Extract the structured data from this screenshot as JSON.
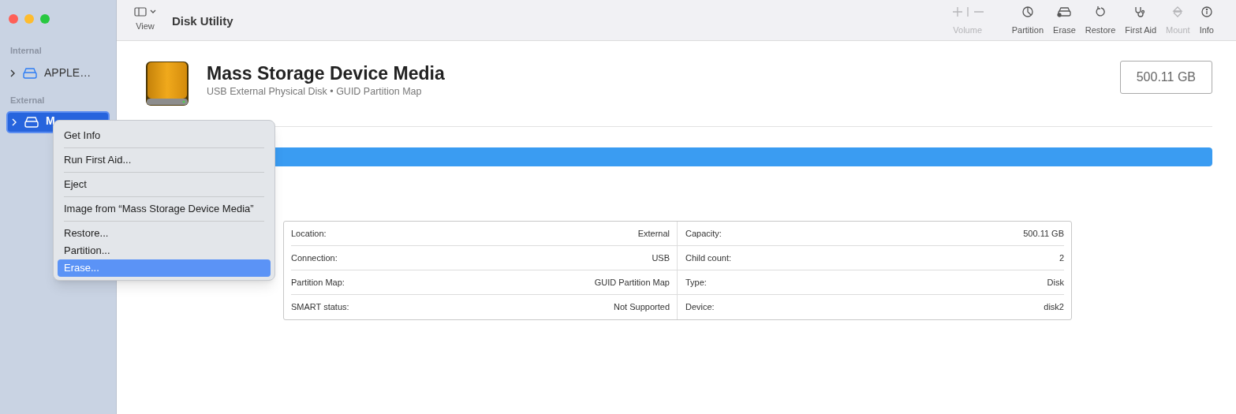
{
  "window": {
    "title": "Disk Utility"
  },
  "view_button": {
    "label": "View"
  },
  "toolbar": [
    {
      "kind": "volume",
      "label": "Volume",
      "disabled": true
    },
    {
      "kind": "partition",
      "label": "Partition",
      "disabled": false
    },
    {
      "kind": "erase",
      "label": "Erase",
      "disabled": false
    },
    {
      "kind": "restore",
      "label": "Restore",
      "disabled": false
    },
    {
      "kind": "firstaid",
      "label": "First Aid",
      "disabled": false
    },
    {
      "kind": "mount",
      "label": "Mount",
      "disabled": true
    },
    {
      "kind": "info",
      "label": "Info",
      "disabled": false
    }
  ],
  "sidebar": {
    "sections": [
      {
        "heading": "Internal",
        "items": [
          {
            "label": "APPLE…",
            "selected": false
          }
        ]
      },
      {
        "heading": "External",
        "items": [
          {
            "label": "M",
            "selected": true
          }
        ]
      }
    ]
  },
  "disk": {
    "name": "Mass Storage Device Media",
    "subtitle": "USB External Physical Disk • GUID Partition Map",
    "size": "500.11 GB",
    "usage": {
      "level": 1
    }
  },
  "details": [
    {
      "label": "Location:",
      "value": "External",
      "label2": "Capacity:",
      "value2": "500.11 GB"
    },
    {
      "label": "Connection:",
      "value": "USB",
      "label2": "Child count:",
      "value2": "2"
    },
    {
      "label": "Partition Map:",
      "value": "GUID Partition Map",
      "label2": "Type:",
      "value2": "Disk"
    },
    {
      "label": "SMART status:",
      "value": "Not Supported",
      "label2": "Device:",
      "value2": "disk2"
    }
  ],
  "context_menu": {
    "groups": [
      [
        {
          "label": "Get Info",
          "selected": false
        }
      ],
      [
        {
          "label": "Run First Aid...",
          "selected": false
        }
      ],
      [
        {
          "label": "Eject",
          "selected": false
        }
      ],
      [
        {
          "label": "Image from “Mass Storage Device Media”",
          "selected": false
        }
      ],
      [
        {
          "label": "Restore...",
          "selected": false
        },
        {
          "label": "Partition...",
          "selected": false
        },
        {
          "label": "Erase...",
          "selected": true
        }
      ]
    ]
  }
}
